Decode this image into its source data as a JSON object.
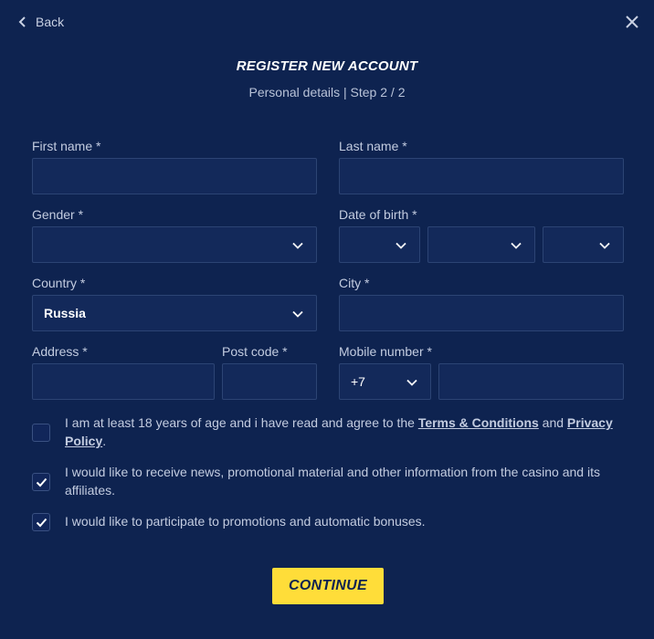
{
  "header": {
    "back_label": "Back",
    "title": "REGISTER NEW ACCOUNT",
    "subtitle": "Personal details | Step 2 / 2"
  },
  "form": {
    "first_name": {
      "label": "First name *",
      "value": ""
    },
    "last_name": {
      "label": "Last name *",
      "value": ""
    },
    "gender": {
      "label": "Gender *",
      "value": ""
    },
    "date_of_birth": {
      "label": "Date of birth *",
      "day": "",
      "month": "",
      "year": ""
    },
    "country": {
      "label": "Country *",
      "value": "Russia"
    },
    "city": {
      "label": "City *",
      "value": ""
    },
    "address": {
      "label": "Address *",
      "value": ""
    },
    "post_code": {
      "label": "Post code *",
      "value": ""
    },
    "mobile": {
      "label": "Mobile number *",
      "prefix": "+7",
      "value": ""
    }
  },
  "consents": [
    {
      "checked": false,
      "text_before": "I am at least 18 years of age and i have read and agree to the ",
      "link1": "Terms & Conditions",
      "text_mid": " and ",
      "link2": "Privacy Policy",
      "text_after": "."
    },
    {
      "checked": true,
      "text": "I would like to receive news, promotional material and other information from the casino and its affiliates."
    },
    {
      "checked": true,
      "text": "I would like to participate to promotions and automatic bonuses."
    }
  ],
  "actions": {
    "continue_label": "CONTINUE"
  },
  "icons": {
    "back": "chevron-left-icon",
    "close": "close-icon",
    "dropdown": "chevron-down-icon",
    "check": "check-icon"
  },
  "colors": {
    "background": "#0e2350",
    "field": "#13295a",
    "accent": "#ffdd39"
  }
}
